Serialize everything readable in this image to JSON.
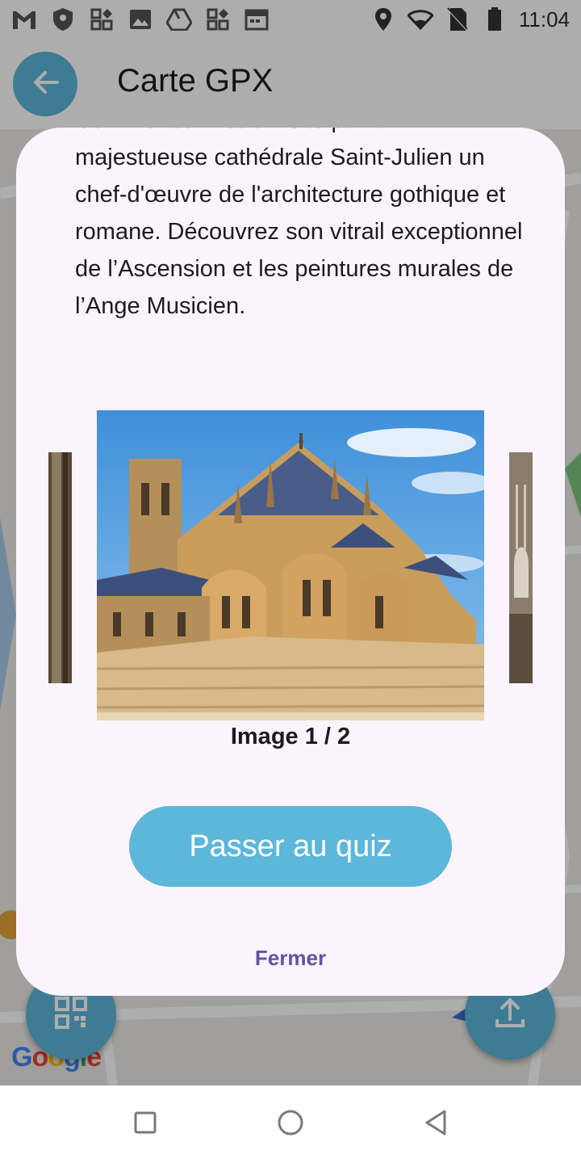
{
  "status_bar": {
    "time": "11:04",
    "icons": [
      "gmail-icon",
      "shield-icon",
      "widgets-icon",
      "image-icon",
      "drive-icon",
      "widgets-icon",
      "calendar-icon",
      "location-icon",
      "wifi-icon",
      "no-sim-icon",
      "battery-icon"
    ]
  },
  "app_bar": {
    "title": "Carte GPX",
    "back_icon": "arrow-back-icon"
  },
  "map": {
    "labels": [
      "Google"
    ]
  },
  "fabs": {
    "left_icon": "qr-code-icon",
    "right_icon": "upload-icon"
  },
  "dialog": {
    "description": "Commencez votre visite par la majestueuse cathédrale Saint-Julien un chef-d'œuvre de l'architecture gothique et romane. Découvrez son vitrail exceptionnel de l’Ascension et les peintures murales de l’Ange Musicien.",
    "image_counter": "Image 1 / 2",
    "primary_button": "Passer au quiz",
    "close_button": "Fermer"
  },
  "colors": {
    "accent": "#5cb7d9",
    "dialog_bg": "#fcf4fc",
    "text_button": "#6750a4"
  },
  "nav_bar": {
    "icons": [
      "recents-square-icon",
      "home-circle-icon",
      "back-triangle-icon"
    ]
  }
}
